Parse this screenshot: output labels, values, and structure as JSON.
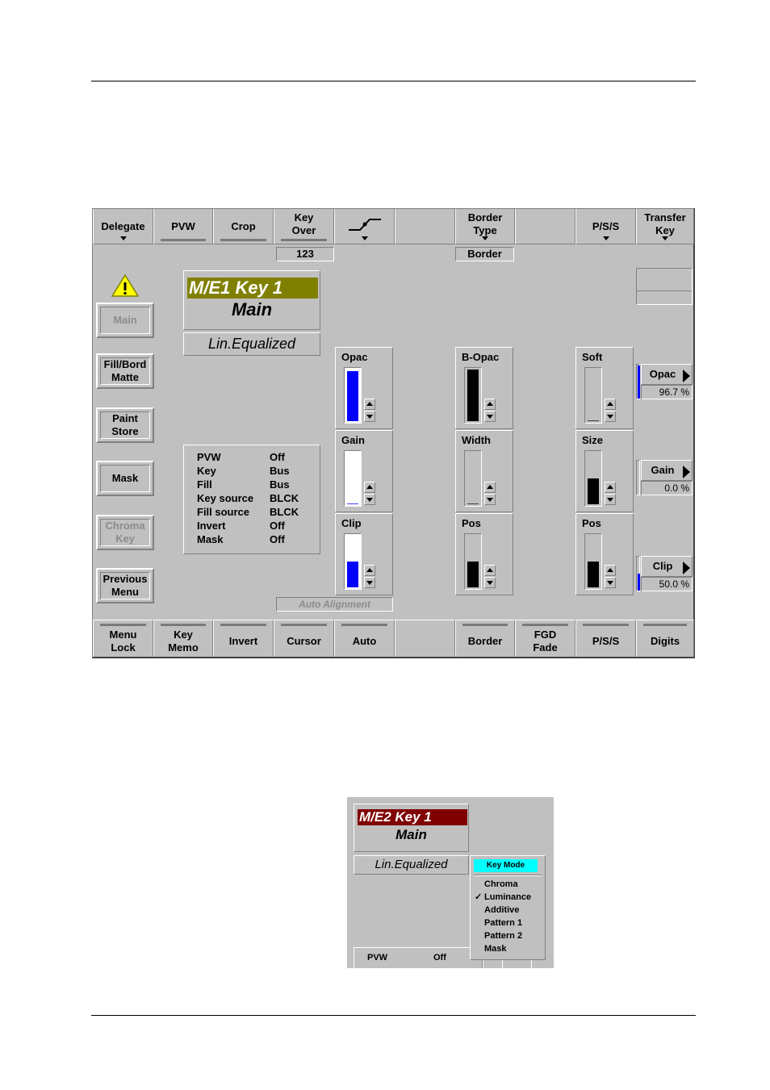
{
  "main_panel": {
    "top_buttons": [
      {
        "label1": "Delegate",
        "label2": "",
        "indicator": "dropdown"
      },
      {
        "label1": "PVW",
        "label2": "",
        "indicator": "bar"
      },
      {
        "label1": "Crop",
        "label2": "",
        "indicator": "bar"
      },
      {
        "label1": "Key",
        "label2": "Over",
        "indicator": "bar"
      },
      {
        "label1": "",
        "label2": "",
        "indicator": "dropdown",
        "icon": "transition-curve-icon"
      },
      {
        "label1": "",
        "label2": "",
        "indicator": "none"
      },
      {
        "label1": "Border",
        "label2": "Type",
        "indicator": "dropdown"
      },
      {
        "label1": "",
        "label2": "",
        "indicator": "none"
      },
      {
        "label1": "P/S/S",
        "label2": "",
        "indicator": "dropdown"
      },
      {
        "label1": "Transfer",
        "label2": "Key",
        "indicator": "dropdown"
      }
    ],
    "status_fields": {
      "key_over_value": "123",
      "border_type_value": "Border"
    },
    "warning_icon": "warning-triangle-icon",
    "side_buttons": [
      {
        "label1": "Main",
        "label2": "",
        "enabled": false
      },
      {
        "label1": "Fill/Bord",
        "label2": "Matte",
        "enabled": true
      },
      {
        "label1": "Paint",
        "label2": "Store",
        "enabled": true
      },
      {
        "label1": "Mask",
        "label2": "",
        "enabled": true
      },
      {
        "label1": "Chroma",
        "label2": "Key",
        "enabled": false
      },
      {
        "label1": "Previous",
        "label2": "Menu",
        "enabled": true
      }
    ],
    "key_title": {
      "name": "M/E1 Key 1",
      "sub": "Main",
      "name_bg": "#808000"
    },
    "key_mode": "Lin.Equalized",
    "info_table": [
      {
        "key": "PVW",
        "value": "Off"
      },
      {
        "key": "Key",
        "value": "Bus"
      },
      {
        "key": "Fill",
        "value": "Bus"
      },
      {
        "key": "Key source",
        "value": "BLCK"
      },
      {
        "key": "Fill source",
        "value": "BLCK"
      },
      {
        "key": "Invert",
        "value": "Off"
      },
      {
        "key": "Mask",
        "value": "Off"
      }
    ],
    "faders": [
      {
        "label": "Opac",
        "level": 0.967,
        "color": "#0000ff",
        "track_bg": "#ffffff"
      },
      {
        "label": "Gain",
        "level": 0.0,
        "color": "#0000ff",
        "track_bg": "#ffffff"
      },
      {
        "label": "Clip",
        "level": 0.5,
        "color": "#0000ff",
        "track_bg": "#ffffff"
      },
      {
        "label": "B-Opac",
        "level": 1.0,
        "color": "#000000",
        "track_bg": "#c0c0c0"
      },
      {
        "label": "Width",
        "level": 0.0,
        "color": "#000000",
        "track_bg": "#c0c0c0"
      },
      {
        "label": "Pos",
        "level": 0.5,
        "color": "#000000",
        "track_bg": "#c0c0c0"
      },
      {
        "label": "Soft",
        "level": 0.0,
        "color": "#000000",
        "track_bg": "#c0c0c0"
      },
      {
        "label": "Size",
        "level": 0.5,
        "color": "#000000",
        "track_bg": "#c0c0c0"
      },
      {
        "label": "Pos",
        "level": 0.5,
        "color": "#000000",
        "track_bg": "#c0c0c0"
      }
    ],
    "value_buttons": [
      {
        "label": "Opac",
        "value": "96.7 %",
        "level": 0.967
      },
      {
        "label": "Gain",
        "value": "0.0 %",
        "level": 0.0
      },
      {
        "label": "Clip",
        "value": "50.0 %",
        "level": 0.5
      }
    ],
    "auto_alignment": "Auto Alignment",
    "bottom_buttons": [
      {
        "label1": "Menu",
        "label2": "Lock",
        "bar": true
      },
      {
        "label1": "Key",
        "label2": "Memo",
        "bar": true
      },
      {
        "label1": "Invert",
        "label2": "",
        "bar": true
      },
      {
        "label1": "Cursor",
        "label2": "",
        "bar": true
      },
      {
        "label1": "Auto",
        "label2": "",
        "bar": true
      },
      {
        "label1": "",
        "label2": "",
        "bar": false
      },
      {
        "label1": "Border",
        "label2": "",
        "bar": true
      },
      {
        "label1": "FGD",
        "label2": "Fade",
        "bar": true
      },
      {
        "label1": "P/S/S",
        "label2": "",
        "bar": true
      },
      {
        "label1": "Digits",
        "label2": "",
        "bar": true
      }
    ]
  },
  "inset_panel": {
    "key_title": {
      "name": "M/E2 Key 1",
      "sub": "Main",
      "name_bg": "#800000"
    },
    "key_mode": "Lin.Equalized",
    "menu": {
      "header": "Key Mode",
      "header_bg": "#00ffff",
      "items": [
        {
          "label": "Chroma",
          "checked": false
        },
        {
          "label": "Luminance",
          "checked": true
        },
        {
          "label": "Additive",
          "checked": false
        },
        {
          "label": "Pattern 1",
          "checked": false
        },
        {
          "label": "Pattern 2",
          "checked": false
        },
        {
          "label": "Mask",
          "checked": false
        }
      ],
      "check_glyph": "✓"
    },
    "partial_row": {
      "key": "PVW",
      "value": "Off"
    }
  }
}
